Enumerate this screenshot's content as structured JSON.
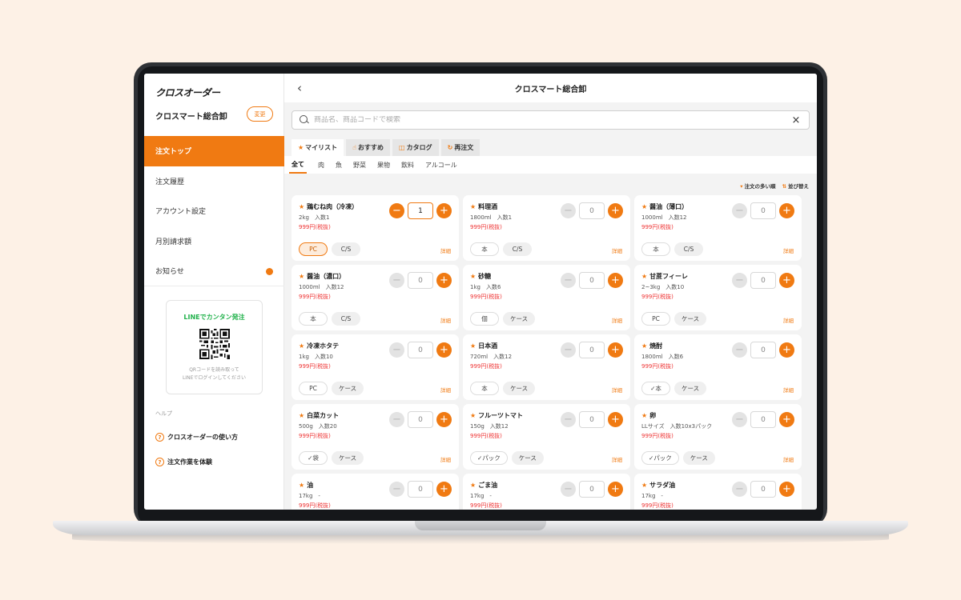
{
  "app": {
    "logo": "クロスオーダー",
    "store_name": "クロスマート総合卸",
    "change_label": "変更"
  },
  "nav": [
    {
      "label": "注文トップ",
      "active": true
    },
    {
      "label": "注文履歴"
    },
    {
      "label": "アカウント設定"
    },
    {
      "label": "月別請求額"
    },
    {
      "label": "お知らせ",
      "badge": true
    }
  ],
  "line_box": {
    "title": "LINEでカンタン発注",
    "note": "QRコードを読み取って\nLINEでログインしてください"
  },
  "help": {
    "label": "ヘルプ",
    "items": [
      "クロスオーダーの使い方",
      "注文作業を体験"
    ]
  },
  "header": {
    "back_icon": "‹",
    "title": "クロスマート総合卸"
  },
  "search": {
    "placeholder": "商品名、商品コードで検索",
    "clear_icon": "×"
  },
  "tabs": [
    {
      "icon": "★",
      "label": "マイリスト",
      "active": true
    },
    {
      "icon": "☝",
      "label": "おすすめ"
    },
    {
      "icon": "◫",
      "label": "カタログ"
    },
    {
      "icon": "↻",
      "label": "再注文"
    }
  ],
  "categories": [
    "全て",
    "肉",
    "魚",
    "野菜",
    "果物",
    "飲料",
    "アルコール"
  ],
  "sort": {
    "order_label": "注文の多い順",
    "sort_label": "並び替え"
  },
  "detail_label": "詳細",
  "products": [
    {
      "name": "鶏むね肉（冷凍）",
      "spec": "2kg　入数1",
      "price": "999円(税抜)",
      "qty": "1",
      "active": true,
      "units": [
        {
          "label": "PC",
          "state": "sel"
        },
        {
          "label": "C/S",
          "state": "gray"
        }
      ]
    },
    {
      "name": "料理酒",
      "spec": "1800ml　入数1",
      "price": "999円(税抜)",
      "qty": "0",
      "units": [
        {
          "label": "本",
          "state": "outline"
        },
        {
          "label": "C/S",
          "state": "gray"
        }
      ]
    },
    {
      "name": "醤油（薄口）",
      "spec": "1000ml　入数12",
      "price": "999円(税抜)",
      "qty": "0",
      "units": [
        {
          "label": "本",
          "state": "outline"
        },
        {
          "label": "C/S",
          "state": "gray"
        }
      ]
    },
    {
      "name": "醤油（濃口）",
      "spec": "1000ml　入数12",
      "price": "999円(税抜)",
      "qty": "0",
      "units": [
        {
          "label": "本",
          "state": "outline"
        },
        {
          "label": "C/S",
          "state": "gray"
        }
      ]
    },
    {
      "name": "砂糖",
      "spec": "1kg　入数6",
      "price": "999円(税抜)",
      "qty": "0",
      "units": [
        {
          "label": "個",
          "state": "outline"
        },
        {
          "label": "ケース",
          "state": "gray"
        }
      ]
    },
    {
      "name": "甘蔗フィーレ",
      "spec": "2~3kg　入数10",
      "price": "999円(税抜)",
      "qty": "0",
      "units": [
        {
          "label": "PC",
          "state": "outline"
        },
        {
          "label": "ケース",
          "state": "gray"
        }
      ]
    },
    {
      "name": "冷凍ホタテ",
      "spec": "1kg　入数10",
      "price": "999円(税抜)",
      "qty": "0",
      "units": [
        {
          "label": "PC",
          "state": "outline"
        },
        {
          "label": "ケース",
          "state": "gray"
        }
      ]
    },
    {
      "name": "日本酒",
      "spec": "720ml　入数12",
      "price": "999円(税抜)",
      "qty": "0",
      "units": [
        {
          "label": "本",
          "state": "outline"
        },
        {
          "label": "ケース",
          "state": "gray"
        }
      ]
    },
    {
      "name": "焼酎",
      "spec": "1800ml　入数6",
      "price": "999円(税抜)",
      "qty": "0",
      "units": [
        {
          "label": "✓本",
          "state": "outline"
        },
        {
          "label": "ケース",
          "state": "gray"
        }
      ]
    },
    {
      "name": "白菜カット",
      "spec": "500g　入数20",
      "price": "999円(税抜)",
      "qty": "0",
      "units": [
        {
          "label": "✓袋",
          "state": "outline"
        },
        {
          "label": "ケース",
          "state": "gray"
        }
      ]
    },
    {
      "name": "フルーツトマト",
      "spec": "150g　入数12",
      "price": "999円(税抜)",
      "qty": "0",
      "units": [
        {
          "label": "✓パック",
          "state": "outline"
        },
        {
          "label": "ケース",
          "state": "gray"
        }
      ]
    },
    {
      "name": "卵",
      "spec": "LLサイズ　入数10x3パック",
      "price": "999円(税抜)",
      "qty": "0",
      "units": [
        {
          "label": "✓パック",
          "state": "outline"
        },
        {
          "label": "ケース",
          "state": "gray"
        }
      ]
    },
    {
      "name": "油",
      "spec": "17kg　-",
      "price": "999円(税抜)",
      "qty": "0",
      "units": []
    },
    {
      "name": "ごま油",
      "spec": "17kg　-",
      "price": "999円(税抜)",
      "qty": "0",
      "units": []
    },
    {
      "name": "サラダ油",
      "spec": "17kg　-",
      "price": "999円(税抜)",
      "qty": "0",
      "units": []
    }
  ],
  "colors": {
    "accent": "#f07a12",
    "price": "#e33333",
    "line_green": "#22b24c",
    "background": "#fdf1e6"
  }
}
